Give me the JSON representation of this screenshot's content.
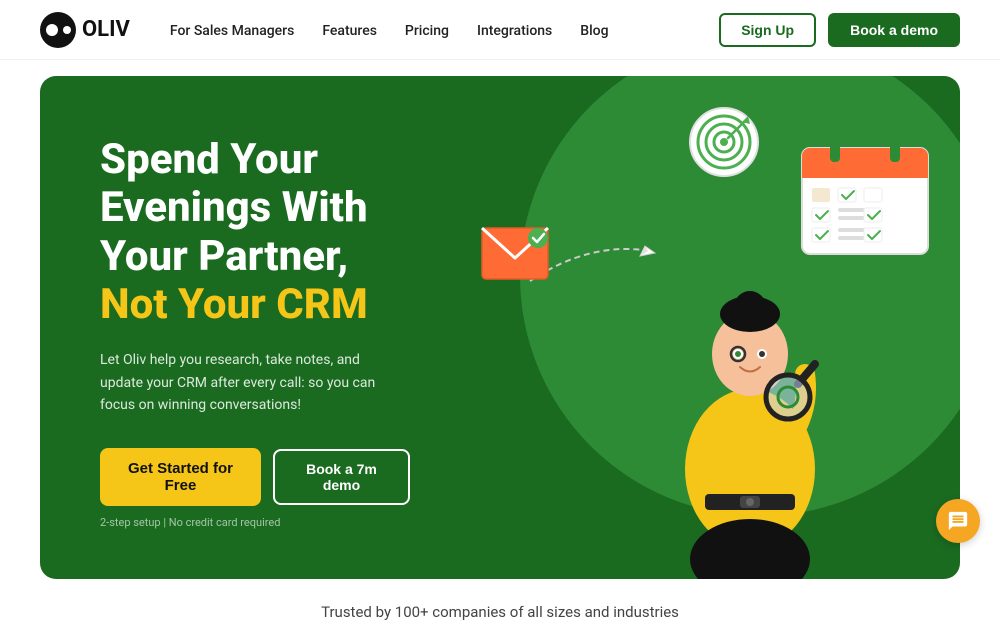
{
  "brand": {
    "name": "OLIV",
    "logo_alt": "Oliv logo"
  },
  "nav": {
    "links": [
      {
        "label": "For Sales Managers",
        "href": "#"
      },
      {
        "label": "Features",
        "href": "#"
      },
      {
        "label": "Pricing",
        "href": "#"
      },
      {
        "label": "Integrations",
        "href": "#"
      },
      {
        "label": "Blog",
        "href": "#"
      }
    ],
    "signup_label": "Sign Up",
    "demo_label": "Book a demo"
  },
  "hero": {
    "title_line1": "Spend Your",
    "title_line2": "Evenings With",
    "title_line3": "Your Partner,",
    "title_accent": "Not Your CRM",
    "description": "Let Oliv help you research, take notes, and update your CRM after every call: so you can focus on winning conversations!",
    "cta_primary": "Get Started for Free",
    "cta_secondary": "Book a 7m demo",
    "note": "2-step setup | No credit card required"
  },
  "trusted": {
    "text": "Trusted by 100+ companies of all sizes and industries"
  },
  "colors": {
    "brand_green": "#1a6b20",
    "brand_yellow": "#f5c518",
    "blob_green": "#2d8a35"
  }
}
